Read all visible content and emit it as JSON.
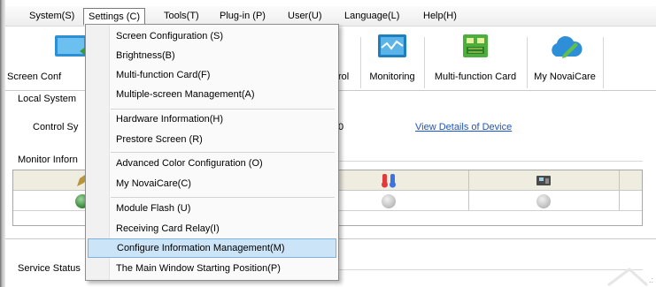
{
  "menubar": {
    "items": [
      {
        "label": "System(S)"
      },
      {
        "label": "Settings (C)"
      },
      {
        "label": "Tools(T)"
      },
      {
        "label": "Plug-in (P)"
      },
      {
        "label": "User(U)"
      },
      {
        "label": "Language(L)"
      },
      {
        "label": "Help(H)"
      }
    ]
  },
  "toolbar": {
    "items": [
      {
        "label": "Screen Conf"
      },
      {
        "label": "rol"
      },
      {
        "label": "Monitoring"
      },
      {
        "label": "Multi-function Card"
      },
      {
        "label": "My NovaiCare"
      }
    ]
  },
  "local_system": {
    "title": "Local System",
    "control_label": "Control Sy",
    "count": "0",
    "details_link": "View Details of Device"
  },
  "monitor": {
    "title": "Monitor Inforn",
    "cells": [
      "",
      "",
      "",
      ""
    ]
  },
  "service_status": {
    "title": "Service Status"
  },
  "dropdown": {
    "groups": [
      [
        "Screen Configuration (S)",
        "Brightness(B)",
        "Multi-function Card(F)",
        "Multiple-screen Management(A)"
      ],
      [
        "Hardware Information(H)",
        "Prestore Screen (R)"
      ],
      [
        "Advanced Color Configuration (O)",
        "My NovaiCare(C)"
      ],
      [
        "Module Flash (U)",
        "Receiving Card Relay(I)",
        "Configure Information Management(M)",
        "The Main Window Starting Position(P)"
      ]
    ],
    "highlighted": "Configure Information Management(M)"
  },
  "colors": {
    "link": "#1a54c8",
    "highlight": "#cce4f7",
    "header_bg": "#efece0"
  }
}
